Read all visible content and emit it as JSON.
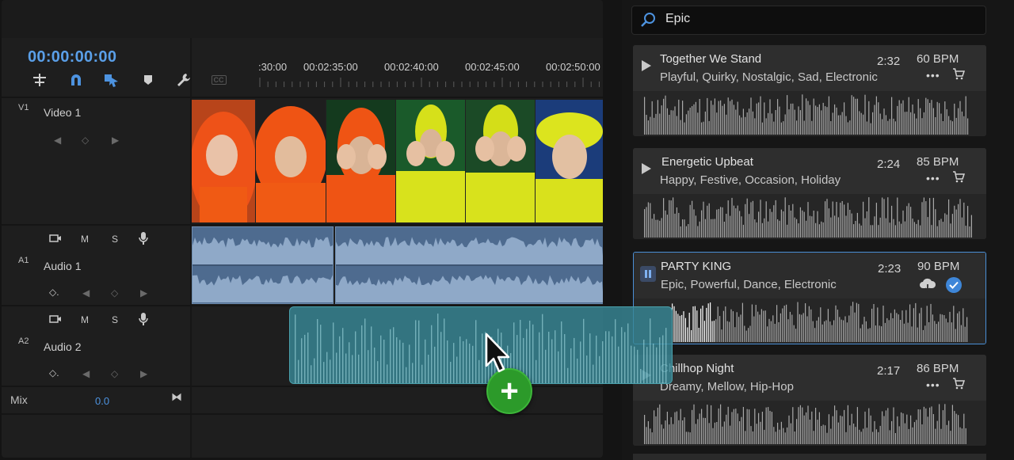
{
  "timeline": {
    "timecode": "00:00:00:00",
    "ruler_labels": [
      ":30:00",
      "00:02:35:00",
      "00:02:40:00",
      "00:02:45:00",
      "00:02:50:00"
    ],
    "tracks": [
      {
        "id": "V1",
        "name": "Video 1"
      },
      {
        "id": "A1",
        "name": "Audio 1"
      },
      {
        "id": "A2",
        "name": "Audio 2"
      }
    ],
    "track_buttons": {
      "mute": "M",
      "solo": "S"
    },
    "mix": {
      "label": "Mix",
      "value": "0.0"
    },
    "tools": [
      "ripple-edit-icon",
      "magnet-icon",
      "linked-selection-icon",
      "marker-icon",
      "wrench-icon",
      "captions-icon"
    ],
    "captions_label": "CC"
  },
  "music": {
    "search": {
      "value": "Epic"
    },
    "tracks": [
      {
        "title": "Together We Stand",
        "tags": "Playful, Quirky, Nostalgic, Sad, Electronic",
        "duration": "2:32",
        "bpm": "60 BPM",
        "state": "idle"
      },
      {
        "title": "Energetic Upbeat",
        "tags": "Happy, Festive, Occasion, Holiday",
        "duration": "2:24",
        "bpm": "85 BPM",
        "state": "idle"
      },
      {
        "title": "PARTY KING",
        "tags": "Epic, Powerful, Dance, Electronic",
        "duration": "2:23",
        "bpm": "90 BPM",
        "state": "playing"
      },
      {
        "title": "Chillhop Night",
        "tags": "Dreamy, Mellow, Hip-Hop",
        "duration": "2:17",
        "bpm": "86 BPM",
        "state": "idle"
      }
    ],
    "more_label": "•••"
  },
  "drag": {
    "badge": "+"
  },
  "colors": {
    "accent": "#4a8fd6",
    "timecode": "#5a9fe8",
    "audio_clip": "#4e6b8f",
    "drag_clip": "#388896",
    "add_badge": "#2c9a2a"
  }
}
